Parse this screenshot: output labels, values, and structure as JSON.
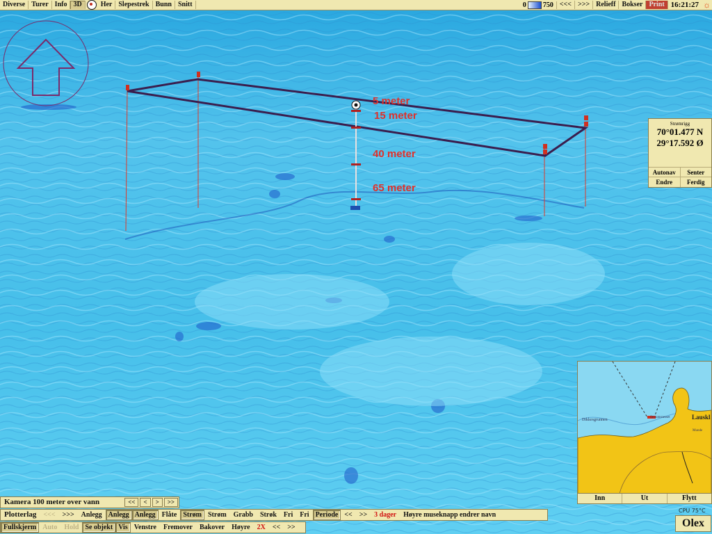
{
  "topbar": {
    "left_buttons": [
      "Diverse",
      "Turer",
      "Info",
      "3D"
    ],
    "right_of_icon_buttons": [
      "Her",
      "Slepestrek",
      "Bunn",
      "Snitt"
    ],
    "depth_min": "0",
    "depth_max": "750",
    "right_buttons": [
      "<<<",
      ">>>",
      "Relieff",
      "Bokser",
      "Print"
    ],
    "clock": "16:21:27"
  },
  "depth_labels": [
    "5 meter",
    "15 meter",
    "40 meter",
    "65 meter"
  ],
  "coord_panel": {
    "title": "Strømrigg",
    "lat": "70°01.477 N",
    "lon": "29°17.592 Ø",
    "buttons_row1": [
      "Autonav",
      "Senter"
    ],
    "buttons_row2": [
      "Endre",
      "Ferdig"
    ]
  },
  "minimap": {
    "place_left": "Dikkesgrunnen",
    "place_mid": "Straumsnesset",
    "place_right": "Lauskl",
    "place_small": "Munde",
    "buttons": [
      "Inn",
      "Ut",
      "Flytt"
    ]
  },
  "camera_row": {
    "label": "Kamera 100 meter over vann",
    "nav": [
      "<<",
      "<",
      ">",
      ">>"
    ]
  },
  "plotter_row": {
    "label": "Plotterlag",
    "items": [
      {
        "text": "<<<",
        "state": "dim"
      },
      {
        "text": ">>>",
        "state": "normal"
      },
      {
        "text": "Anlegg",
        "state": "normal"
      },
      {
        "text": "Anlegg",
        "state": "pressed"
      },
      {
        "text": "Anlegg",
        "state": "pressed"
      },
      {
        "text": "Flåte",
        "state": "normal"
      },
      {
        "text": "Strøm",
        "state": "pressed"
      },
      {
        "text": "Strøm",
        "state": "normal"
      },
      {
        "text": "Grabb",
        "state": "normal"
      },
      {
        "text": "Strøk",
        "state": "normal"
      },
      {
        "text": "Fri",
        "state": "normal"
      },
      {
        "text": "Fri",
        "state": "normal"
      },
      {
        "text": "Periode",
        "state": "pressed"
      },
      {
        "text": "<<",
        "state": "normal"
      },
      {
        "text": ">>",
        "state": "normal"
      },
      {
        "text": "3 dager",
        "state": "red"
      },
      {
        "text": "Høyre museknapp endrer navn",
        "state": "normal"
      }
    ]
  },
  "mode_row": {
    "items": [
      {
        "text": "Fullskjerm",
        "state": "pressed"
      },
      {
        "text": "Auto",
        "state": "dim"
      },
      {
        "text": "Hold",
        "state": "dim"
      },
      {
        "text": "Se objekt",
        "state": "pressed"
      },
      {
        "text": "Vis",
        "state": "pressed"
      },
      {
        "text": "Venstre",
        "state": "normal"
      },
      {
        "text": "Fremover",
        "state": "normal"
      },
      {
        "text": "Bakover",
        "state": "normal"
      },
      {
        "text": "Høyre",
        "state": "normal"
      },
      {
        "text": "2X",
        "state": "red"
      },
      {
        "text": "<<",
        "state": "normal"
      },
      {
        "text": ">>",
        "state": "normal"
      }
    ]
  },
  "cpu": "CPU 75°C",
  "brand": "Olex",
  "colors": {
    "water": "#3fb8e6",
    "land": "#f2c416",
    "panel": "#f0e8b0",
    "accent": "#e0302a",
    "frame": "#4a2a5a"
  }
}
